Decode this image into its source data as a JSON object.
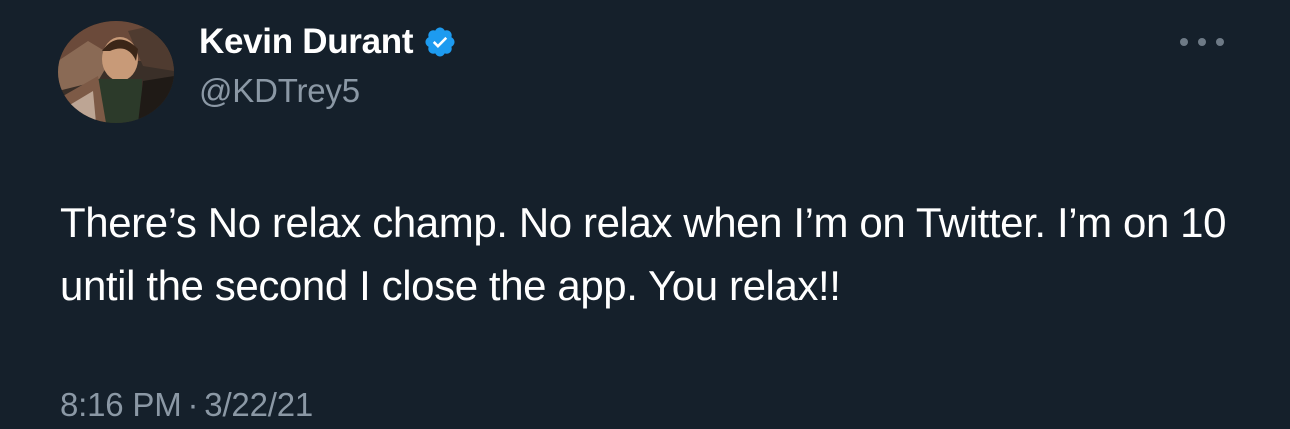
{
  "author": {
    "display_name": "Kevin Durant",
    "handle": "@KDTrey5",
    "verified": true,
    "avatar_icon": "profile-avatar"
  },
  "tweet": {
    "text": "There’s No relax champ. No relax when I’m on Twitter. I’m on 10 until the second I close the app. You relax!!",
    "time": "8:16 PM",
    "separator": "·",
    "date": "3/22/21"
  },
  "icons": {
    "verified_badge": "verified-badge-icon",
    "more": "more-options-icon"
  },
  "colors": {
    "background": "#15202b",
    "primary_text": "#ffffff",
    "secondary_text": "#8b98a5",
    "verified_blue": "#1d9bf0"
  }
}
